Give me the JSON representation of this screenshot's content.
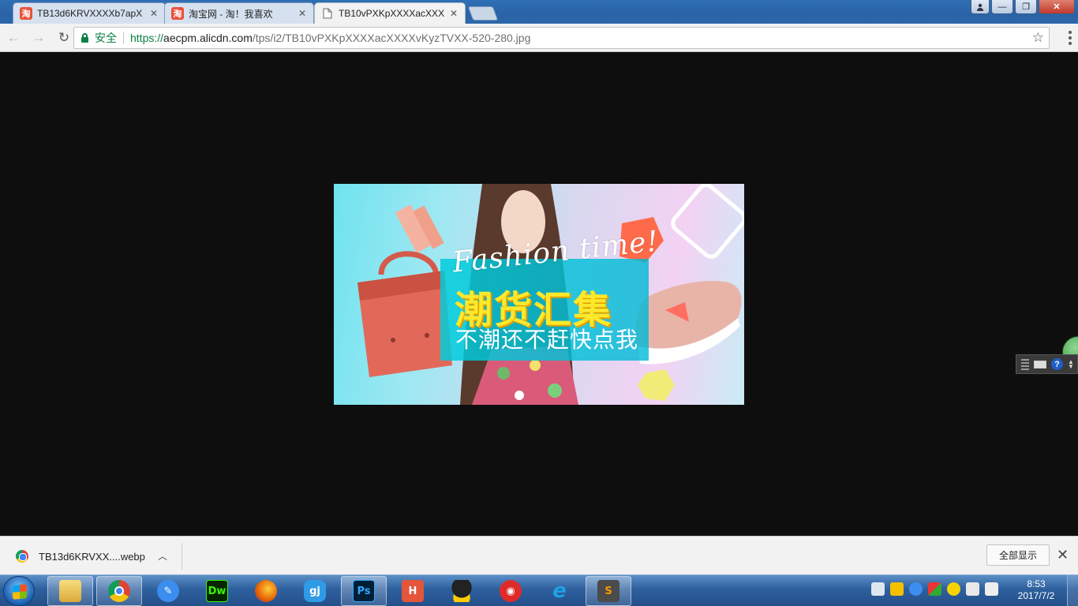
{
  "browser": {
    "tabs": [
      {
        "title": "TB13d6KRVXXXXb7apX",
        "favicon": "taobao-icon",
        "active": false
      },
      {
        "title": "淘宝网 - 淘！我喜欢",
        "favicon": "taobao-icon",
        "active": false
      },
      {
        "title": "TB10vPXKpXXXXacXXX",
        "favicon": "document-icon",
        "active": true
      }
    ],
    "favicon_glyph": "淘",
    "close_glyph": "✕",
    "window_controls": {
      "minimize": "—",
      "maximize": "❐",
      "close": "✕"
    },
    "toolbar": {
      "back": "←",
      "forward": "→",
      "reload": "↻",
      "secure_label": "安全",
      "url_scheme": "https://",
      "url_host": "aecpm.alicdn.com",
      "url_path": "/tps/i2/TB10vPXKpXXXXacXXXXvKyzTVXX-520-280.jpg",
      "bookmark_glyph": "☆"
    }
  },
  "banner": {
    "script_text": "Fashion time!",
    "title": "潮货汇集",
    "subtitle": "不潮还不赶快点我",
    "colors": {
      "title": "#fde82c",
      "box": "#00c8dc",
      "bag": "#e2685a",
      "shoe": "#e8b4a8"
    }
  },
  "download_shelf": {
    "file_name": "TB13d6KRVXX....webp",
    "chevron": "︿",
    "show_all_label": "全部显示",
    "close_glyph": "✕"
  },
  "side_widget": {
    "help_glyph": "?"
  },
  "taskbar": {
    "apps": [
      {
        "name": "file-explorer",
        "label": "",
        "color": "#e8c75a",
        "open": true
      },
      {
        "name": "chrome",
        "label": "",
        "color": "#4285f4",
        "open": true
      },
      {
        "name": "note-app",
        "label": "",
        "color": "#3b8ef0",
        "open": false
      },
      {
        "name": "dreamweaver",
        "label": "Dw",
        "color": "#35fa00",
        "open": false
      },
      {
        "name": "firefox",
        "label": "",
        "color": "#e66000",
        "open": false
      },
      {
        "name": "gqi-app",
        "label": "gj",
        "color": "#2f9be6",
        "open": false
      },
      {
        "name": "photoshop",
        "label": "Ps",
        "color": "#31a8ff",
        "open": true
      },
      {
        "name": "hbuilder",
        "label": "H",
        "color": "#e4553b",
        "open": false
      },
      {
        "name": "qq",
        "label": "",
        "color": "#111111",
        "open": false
      },
      {
        "name": "netease-music",
        "label": "",
        "color": "#e02a2a",
        "open": false
      },
      {
        "name": "internet-explorer",
        "label": "e",
        "color": "#1ea0e6",
        "open": false
      },
      {
        "name": "sublime-text",
        "label": "S",
        "color": "#4b4b4b",
        "open": true
      }
    ],
    "clock_time": "8:53",
    "clock_date": "2017/7/2"
  }
}
